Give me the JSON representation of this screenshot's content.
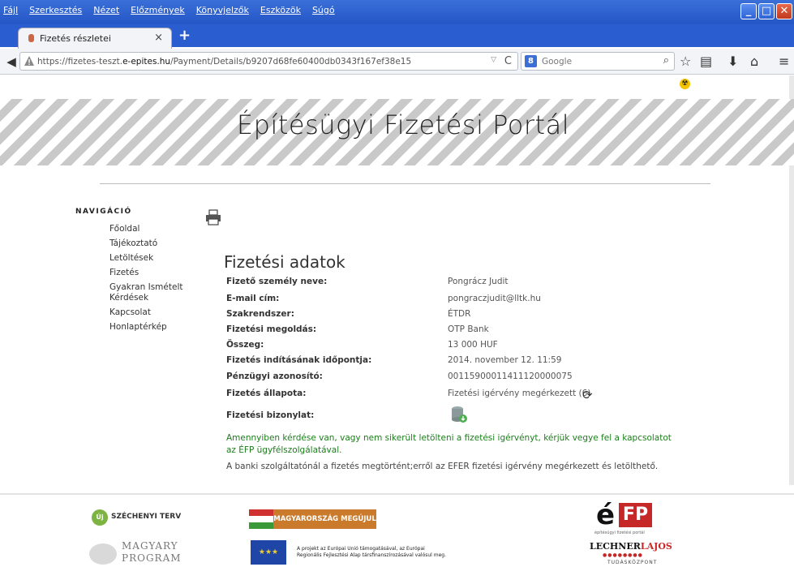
{
  "menu": [
    "Fájl",
    "Szerkesztés",
    "Nézet",
    "Előzmények",
    "Könyvjelzők",
    "Eszközök",
    "Súgó"
  ],
  "tab": {
    "title": "Fizetés részletei"
  },
  "address": {
    "prefix": "https://fizetes-teszt.",
    "host": "e-epites.hu",
    "path": "/Payment/Details/b9207d68fe60400db0343f167ef38e15"
  },
  "search": {
    "engine_label": "8",
    "placeholder": "Google"
  },
  "site": {
    "title": "Építésügyi Fizetési Portál"
  },
  "nav": {
    "heading": "NAVIGÁCIÓ",
    "items": [
      "Főoldal",
      "Tájékoztató",
      "Letöltések",
      "Fizetés",
      "Gyakran Ismételt Kérdések",
      "Kapcsolat",
      "Honlaptérkép"
    ]
  },
  "content": {
    "title": "Fizetési adatok",
    "rows": [
      {
        "label": "Fizető személy neve:",
        "value": "Pongrácz Judit"
      },
      {
        "label": "E-mail cím:",
        "value": "pongraczjudit@lltk.hu"
      },
      {
        "label": "Szakrendszer:",
        "value": "ÉTDR"
      },
      {
        "label": "Fizetési megoldás:",
        "value": "OTP Bank"
      },
      {
        "label": "Összeg:",
        "value": "13 000 HUF"
      },
      {
        "label": "Fizetés indításának időpontja:",
        "value": "2014. november 12. 11:59"
      },
      {
        "label": "Pénzügyi azonosító:",
        "value": "00115900011411120000075"
      },
      {
        "label": "Fizetés állapota:",
        "value": "Fizetési igérvény megérkezett (6)"
      },
      {
        "label": "Fizetési bizonylat:",
        "value": ""
      }
    ],
    "notice_green": "Amennyiben kérdése van, vagy nem sikerült letölteni a fizetési igérvényt, kérjük vegye fel a kapcsolatot az ÉFP ügyfélszolgálatával.",
    "notice_grey": "A banki szolgáltatónál a fizetés megtörtént;erről az EFER fizetési igérvény megérkezett és letölthető."
  },
  "footer": {
    "szechenyi": "SZÉCHENYI TERV",
    "szechenyi_icon": "Új",
    "magyary_1": "MAGYARY",
    "magyary_2": "PROGRAM",
    "mm_banner": "MAGYARORSZÁG MEGÚJUL",
    "eu_text_1": "A projekt az Európai Unió támogatásával, az Európai",
    "eu_text_2": "Regionális Fejlesztési Alap társfinanszírozásával valósul meg.",
    "efp_e": "é",
    "efp_box": "FP",
    "efp_sub": "építésügyi fizetési portál",
    "lechner_a": "LECHNER",
    "lechner_b": "LAJOS",
    "tudas": "TUDÁSKÖZPONT"
  }
}
